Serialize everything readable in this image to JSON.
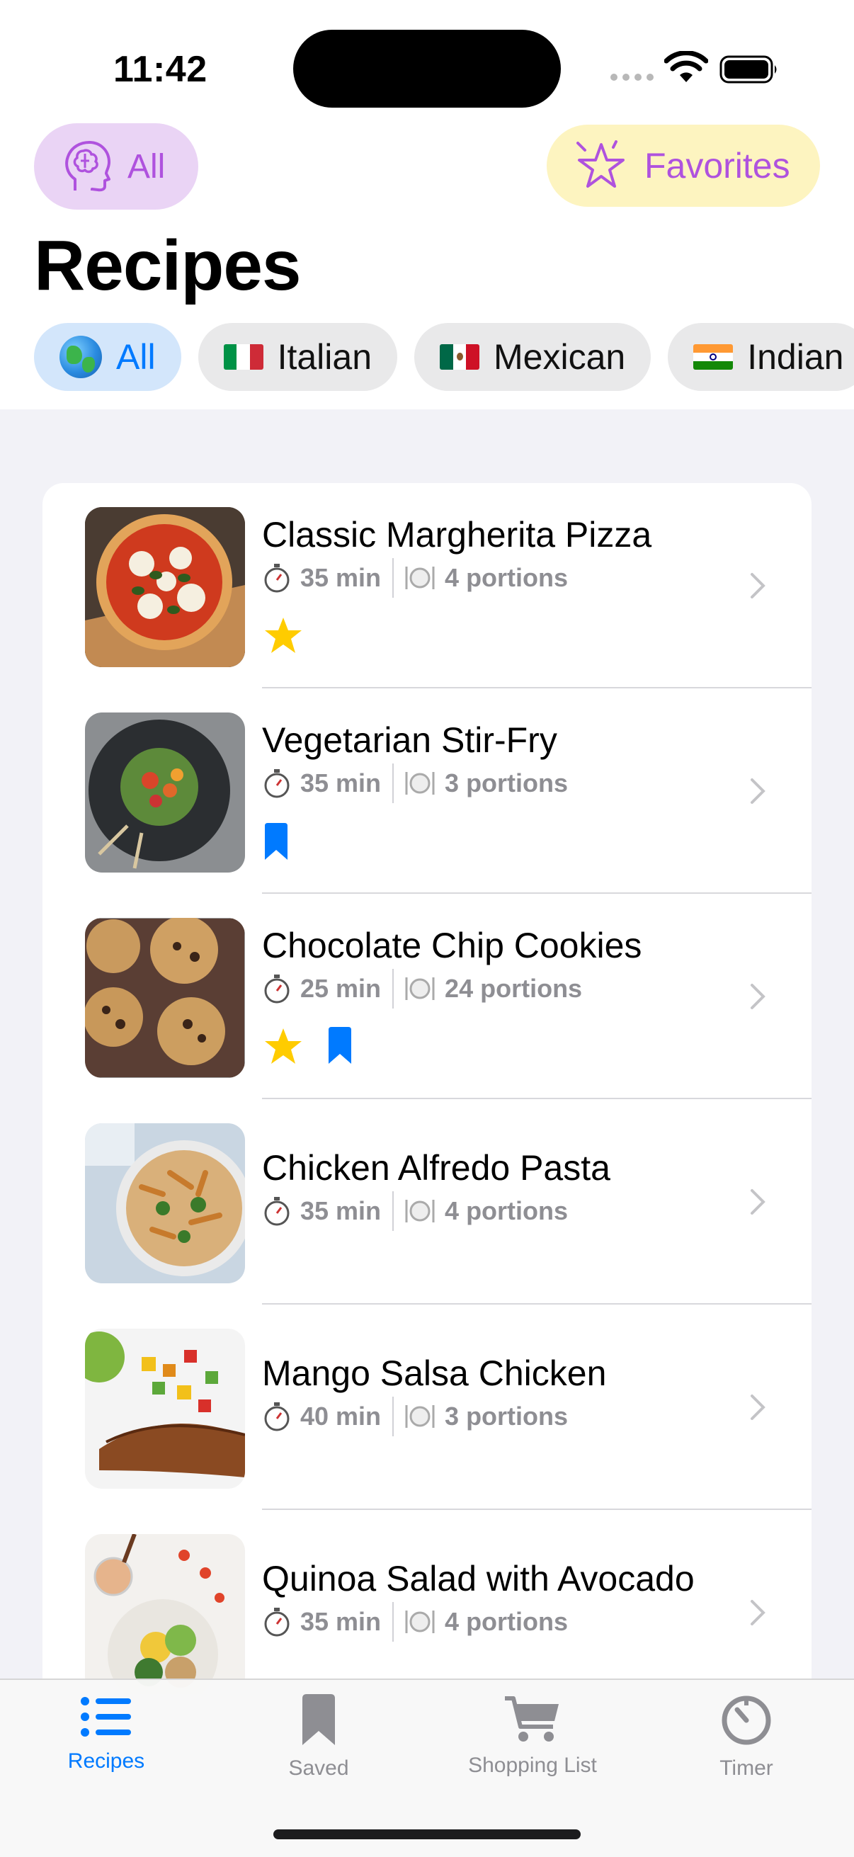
{
  "status_bar": {
    "time": "11:42"
  },
  "header": {
    "filter_pill_label": "All",
    "favorites_label": "Favorites",
    "title": "Recipes"
  },
  "cuisines": [
    {
      "label": "All",
      "icon": "globe-icon",
      "active": true
    },
    {
      "label": "Italian",
      "icon": "italy-flag-icon",
      "active": false
    },
    {
      "label": "Mexican",
      "icon": "mexico-flag-icon",
      "active": false
    },
    {
      "label": "Indian",
      "icon": "india-flag-icon",
      "active": false
    }
  ],
  "recipes": [
    {
      "name": "Classic Margherita Pizza",
      "time": "35 min",
      "portions": "4 portions",
      "favorite": true,
      "saved": false
    },
    {
      "name": "Vegetarian Stir-Fry",
      "time": "35 min",
      "portions": "3 portions",
      "favorite": false,
      "saved": true
    },
    {
      "name": "Chocolate Chip Cookies",
      "time": "25 min",
      "portions": "24 portions",
      "favorite": true,
      "saved": true
    },
    {
      "name": "Chicken Alfredo Pasta",
      "time": "35 min",
      "portions": "4 portions",
      "favorite": false,
      "saved": false
    },
    {
      "name": "Mango Salsa Chicken",
      "time": "40 min",
      "portions": "3 portions",
      "favorite": false,
      "saved": false
    },
    {
      "name": "Quinoa Salad with Avocado",
      "time": "35 min",
      "portions": "4 portions",
      "favorite": false,
      "saved": false
    }
  ],
  "tabs": [
    {
      "label": "Recipes",
      "icon": "list-icon",
      "active": true
    },
    {
      "label": "Saved",
      "icon": "bookmark-icon",
      "active": false
    },
    {
      "label": "Shopping List",
      "icon": "cart-icon",
      "active": false
    },
    {
      "label": "Timer",
      "icon": "timer-icon",
      "active": false
    }
  ],
  "colors": {
    "accent": "#007aff",
    "purple": "#af52de",
    "star": "#ffcc00",
    "filter_pill_bg": "#ead4f5",
    "favorites_pill_bg": "#fdf4c0"
  }
}
